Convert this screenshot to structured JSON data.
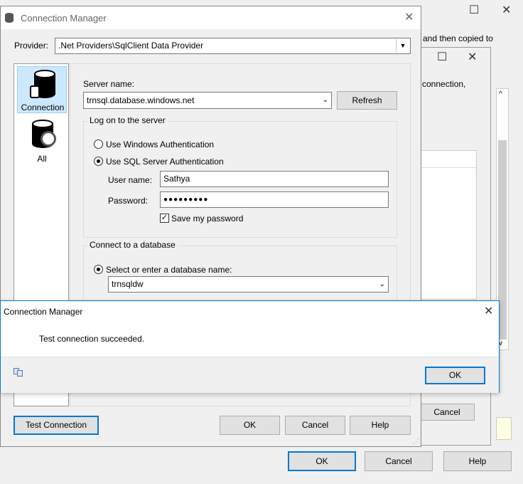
{
  "bg_window": {
    "partial_text_1": "and then copied to",
    "partial_text_2": "connection,",
    "cancel_label": "Cancel",
    "ok_label": "OK",
    "help_label": "Help"
  },
  "main": {
    "title": "Connection Manager",
    "provider_label": "Provider:",
    "provider_value": ".Net Providers\\SqlClient Data Provider",
    "nav": [
      {
        "label": "Connection"
      },
      {
        "label": "All"
      }
    ],
    "server_name_label": "Server name:",
    "server_name_value": "trnsql.database.windows.net",
    "refresh_label": "Refresh",
    "logon_group_title": "Log on to the server",
    "windows_auth_label": "Use Windows Authentication",
    "sql_auth_label": "Use SQL Server Authentication",
    "username_label": "User name:",
    "username_value": "Sathya",
    "password_label": "Password:",
    "password_value": "●●●●●●●●●",
    "save_password_label": "Save my password",
    "db_group_title": "Connect to a database",
    "select_db_label": "Select or enter a database name:",
    "db_value": "trnsqldw",
    "test_connection_label": "Test Connection",
    "ok_label": "OK",
    "cancel_label": "Cancel",
    "help_label": "Help"
  },
  "dialog": {
    "title": "Connection Manager",
    "message": "Test connection succeeded.",
    "ok_label": "OK"
  }
}
